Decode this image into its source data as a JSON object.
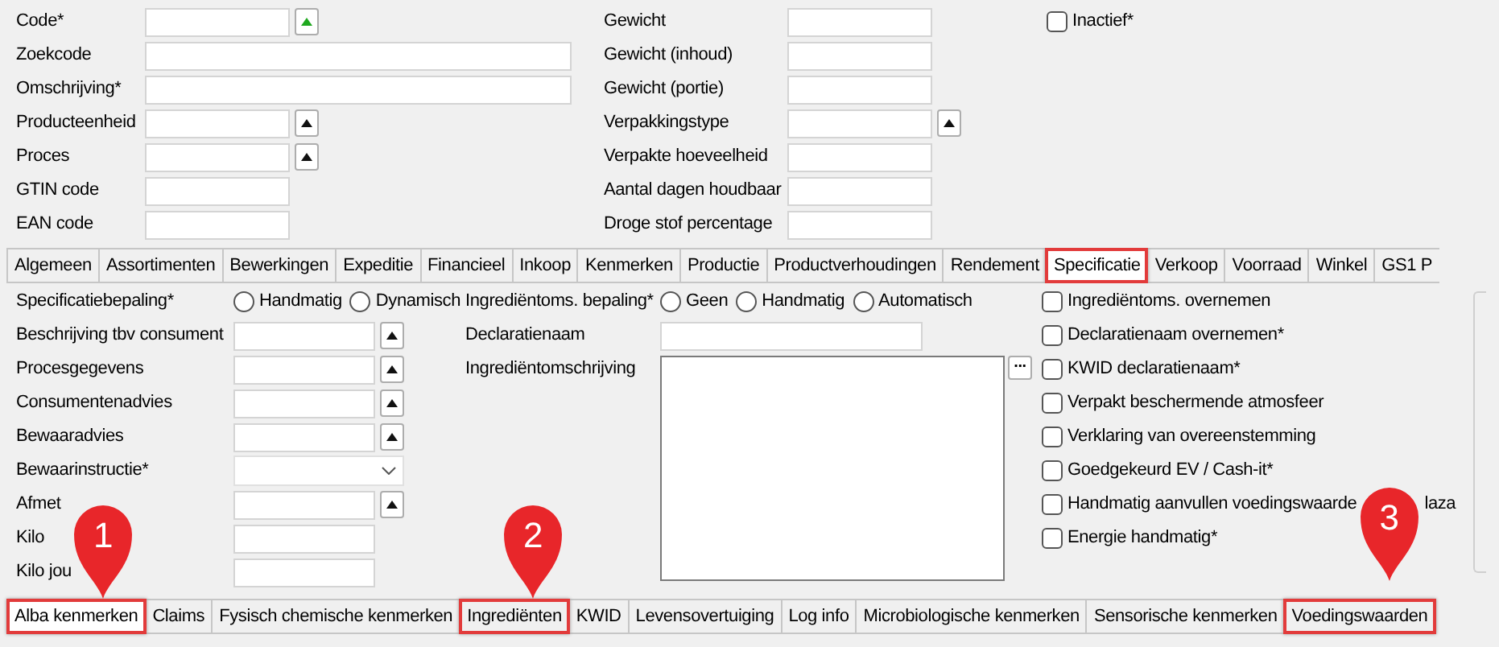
{
  "header": {
    "left_fields": [
      {
        "label": "Code*",
        "kind": "lookup_active"
      },
      {
        "label": "Zoekcode",
        "kind": "wide"
      },
      {
        "label": "Omschrijving*",
        "kind": "wide"
      },
      {
        "label": "Producteenheid",
        "kind": "lookup"
      },
      {
        "label": "Proces",
        "kind": "lookup"
      },
      {
        "label": "GTIN code",
        "kind": "text"
      },
      {
        "label": "EAN code",
        "kind": "text"
      }
    ],
    "middle_fields": [
      {
        "label": "Gewicht",
        "kind": "text"
      },
      {
        "label": "Gewicht (inhoud)",
        "kind": "text"
      },
      {
        "label": "Gewicht (portie)",
        "kind": "text"
      },
      {
        "label": "Verpakkingstype",
        "kind": "lookup"
      },
      {
        "label": "Verpakte hoeveelheid",
        "kind": "text"
      },
      {
        "label": "Aantal dagen houdbaar",
        "kind": "text"
      },
      {
        "label": "Droge stof percentage",
        "kind": "text"
      }
    ],
    "inactive": {
      "label": "Inactief*",
      "checked": false
    }
  },
  "tabs": [
    {
      "label": "Algemeen",
      "selected": false,
      "highlighted": false
    },
    {
      "label": "Assortimenten",
      "selected": false,
      "highlighted": false
    },
    {
      "label": "Bewerkingen",
      "selected": false,
      "highlighted": false
    },
    {
      "label": "Expeditie",
      "selected": false,
      "highlighted": false
    },
    {
      "label": "Financieel",
      "selected": false,
      "highlighted": false
    },
    {
      "label": "Inkoop",
      "selected": false,
      "highlighted": false
    },
    {
      "label": "Kenmerken",
      "selected": false,
      "highlighted": false
    },
    {
      "label": "Productie",
      "selected": false,
      "highlighted": false
    },
    {
      "label": "Productverhoudingen",
      "selected": false,
      "highlighted": false
    },
    {
      "label": "Rendement",
      "selected": false,
      "highlighted": false
    },
    {
      "label": "Specificatie",
      "selected": true,
      "highlighted": true
    },
    {
      "label": "Verkoop",
      "selected": false,
      "highlighted": false
    },
    {
      "label": "Voorraad",
      "selected": false,
      "highlighted": false
    },
    {
      "label": "Winkel",
      "selected": false,
      "highlighted": false
    },
    {
      "label": "GS1 P",
      "selected": false,
      "highlighted": false
    }
  ],
  "specification": {
    "left_fields": [
      {
        "label": "Specificatiebepaling*",
        "kind": "radios",
        "options": [
          {
            "label": "Handmatig",
            "selected": false
          },
          {
            "label": "Dynamisch",
            "selected": false
          }
        ]
      },
      {
        "label": "Beschrijving tbv consument",
        "kind": "lookup"
      },
      {
        "label": "Procesgegevens",
        "kind": "lookup"
      },
      {
        "label": "Consumentenadvies",
        "kind": "lookup"
      },
      {
        "label": "Bewaaradvies",
        "kind": "lookup"
      },
      {
        "label": "Bewaarinstructie*",
        "kind": "dropdown"
      },
      {
        "label": "Afmet",
        "kind": "lookup"
      },
      {
        "label": "Kilo",
        "kind": "text"
      },
      {
        "label": "Kilo jou",
        "kind": "text"
      }
    ],
    "ingredient_determination": {
      "label": "Ingrediëntoms. bepaling*",
      "options": [
        {
          "label": "Geen",
          "selected": false
        },
        {
          "label": "Handmatig",
          "selected": false
        },
        {
          "label": "Automatisch",
          "selected": false
        }
      ]
    },
    "declaration_name": {
      "label": "Declaratienaam"
    },
    "ingredient_description": {
      "label": "Ingrediëntomschrijving",
      "button": "..."
    },
    "checkboxes": [
      {
        "label": "Ingrediëntoms. overnemen",
        "checked": false
      },
      {
        "label": "Declaratienaam overnemen*",
        "checked": false
      },
      {
        "label": "KWID declaratienaam*",
        "checked": false
      },
      {
        "label": "Verpakt beschermende atmosfeer",
        "checked": false
      },
      {
        "label": "Verklaring van overeenstemming",
        "checked": false
      },
      {
        "label": "Goedgekeurd EV / Cash-it*",
        "checked": false
      },
      {
        "label": "Handmatig aanvullen voedingswaarde",
        "label_tail": "laza",
        "checked": false
      },
      {
        "label": "Energie handmatig*",
        "checked": false
      }
    ]
  },
  "subtabs": [
    {
      "label": "Alba kenmerken",
      "selected": true,
      "highlighted": true
    },
    {
      "label": "Claims",
      "selected": false,
      "highlighted": false
    },
    {
      "label": "Fysisch chemische kenmerken",
      "selected": false,
      "highlighted": false
    },
    {
      "label": "Ingrediënten",
      "selected": false,
      "highlighted": true
    },
    {
      "label": "KWID",
      "selected": false,
      "highlighted": false
    },
    {
      "label": "Levensovertuiging",
      "selected": false,
      "highlighted": false
    },
    {
      "label": "Log info",
      "selected": false,
      "highlighted": false
    },
    {
      "label": "Microbiologische kenmerken",
      "selected": false,
      "highlighted": false
    },
    {
      "label": "Sensorische kenmerken",
      "selected": false,
      "highlighted": false
    },
    {
      "label": "Voedingswaarden",
      "selected": false,
      "highlighted": true
    }
  ],
  "callouts": [
    {
      "number": "1"
    },
    {
      "number": "2"
    },
    {
      "number": "3"
    }
  ]
}
